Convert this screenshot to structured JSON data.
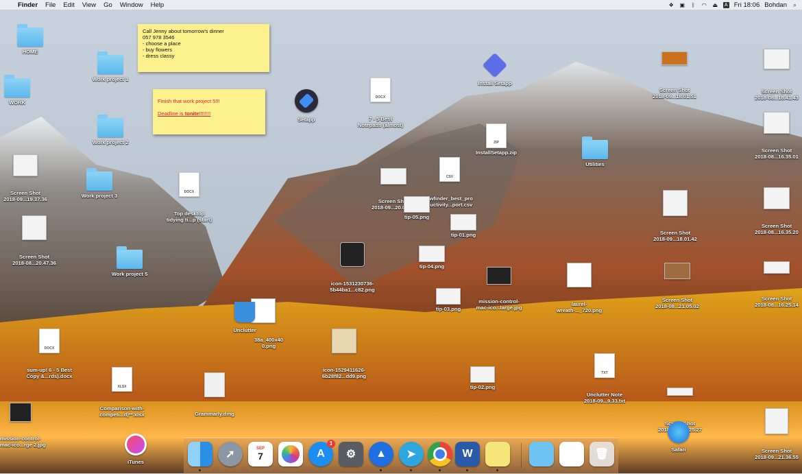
{
  "menubar": {
    "apple": "",
    "app": "Finder",
    "menus": [
      "File",
      "Edit",
      "View",
      "Go",
      "Window",
      "Help"
    ],
    "clock": "Fri 18:06",
    "user": "Bohdan"
  },
  "desktop": {
    "home": "HOME",
    "work": "WORK",
    "wp1": "Work project 1",
    "wp2": "Work project 2",
    "wp3": "Work project 3",
    "wp5": "Work project 5",
    "ss_19": "Screen Shot\n2018-09...19.37.36",
    "ss_20": "Screen Shot\n2018-08...20.47.36",
    "top_desktop": "Top desktop\ntidying ti...p (start)",
    "sumup": "sum-up! 6 - 5 Best\nCopy &...rds).docx",
    "comparison": "Comparison-with-\ncompeti...d)**.xlsx",
    "mc2": "mission-control-\nmac-ico...rge 2.jpg",
    "grammarly": "Grammarly.dmg",
    "unclutter": "Unclutter",
    "a38": "38a_400x40\n0.png",
    "setapp": "Setapp",
    "best_notepads": "7 - 5 Best\nNotepads (almost)",
    "install_setapp": "Install Setapp",
    "install_zip": "InstallSetapp.zip",
    "kwfinder": "kwfinder_best_pro\nductivity...port.csv",
    "ss_mid": "Screen Shot\n2018-09...20.01.07",
    "tip05": "tip-05.png",
    "tip01": "tip-01.png",
    "tip04": "tip-04.png",
    "tip03": "tip-03.png",
    "tip02": "tip-02.png",
    "icon153": "icon-1531230736-\n5b44ba1...c82.png",
    "icon152": "icon-1529411626-\n6b28f82...dd9.png",
    "mc_large": "mission-control-\nmac-ico...large.jpg",
    "laurel": "laurel-\nwreath-..._720.png",
    "utilities": "Utilities",
    "unclutter_note": "Unclutter Note\n2018-09...9.33.txt",
    "ss_r1": "Screen Shot\n2018-09...18.01.51",
    "ss_r2": "Screen Shot\n2018-09...18.01.42",
    "ss_r3": "Screen Shot\n2018-08...21.05.02",
    "ss_r4": "Screen Shot\n2018-08...16.25.27",
    "ss_far1": "Screen Shot\n2018-08...18.41.43",
    "ss_far2": "Screen Shot\n2018-08...16.35.01",
    "ss_far3": "Screen Shot\n2018-08...16.35.20",
    "ss_far4": "Screen Shot\n2018-08...16.25.14",
    "ss_far5": "Screen Shot\n2018-09...21.36.55",
    "itunes": "iTunes",
    "safari": "Safari"
  },
  "sticky1": {
    "lines": [
      "Call Jenny about tomorrow's dinner",
      "057 978 3546",
      "- choose a place",
      "- buy flowers",
      "- dress classy"
    ]
  },
  "sticky2": {
    "line1": "Finish that work project 5!!!",
    "line2a": "Deadline is ",
    "line2b": "tonite",
    "line2c": "!!!!!!!!"
  },
  "file_types": {
    "docx": "DOCX",
    "xlsx": "XLSX",
    "csv": "CSV",
    "zip": "ZIP",
    "txt": "TXT"
  },
  "dock": {
    "calendar_month": "SEP",
    "calendar_day": "7",
    "appstore_badge": "1"
  },
  "colors": {
    "folder": "#6ec3f1",
    "sticky": "#fdf18e",
    "deadline_red": "#e0222b"
  }
}
